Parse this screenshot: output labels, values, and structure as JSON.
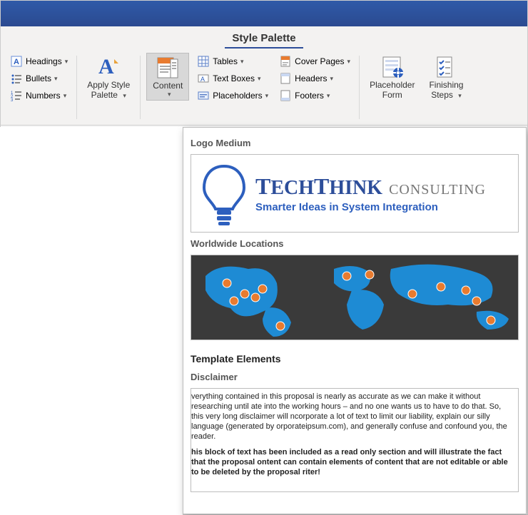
{
  "tab": {
    "label": "Style Palette"
  },
  "ribbon": {
    "styles": {
      "headings": "Headings",
      "bullets": "Bullets",
      "numbers": "Numbers"
    },
    "apply": {
      "label_l1": "Apply Style",
      "label_l2": "Palette"
    },
    "content": {
      "label": "Content"
    },
    "insert_col1": {
      "tables": "Tables",
      "textboxes": "Text Boxes",
      "placeholders": "Placeholders"
    },
    "insert_col2": {
      "cover": "Cover Pages",
      "headers": "Headers",
      "footers": "Footers"
    },
    "form": {
      "label_l1": "Placeholder",
      "label_l2": "Form"
    },
    "finish": {
      "label_l1": "Finishing",
      "label_l2": "Steps"
    }
  },
  "gallery": {
    "logo_head": "Logo Medium",
    "logo_brand_main": "TechThink",
    "logo_brand_sub": "CONSULTING",
    "logo_tag": "Smarter Ideas in System Integration",
    "map_head": "Worldwide Locations",
    "elem_head": "Template Elements",
    "disc_head": "Disclaimer",
    "disc_p1": "verything contained in this proposal is nearly as accurate as we can make it without researching until ate into the working hours – and no one wants us to have to do that. So, this very long disclaimer will ncorporate a lot of text to limit our liability, explain our silly language (generated by orporateipsum.com), and generally confuse and confound you, the reader.",
    "disc_p2": "his block of text has been included as a read only section and will illustrate the fact that the proposal ontent can contain elements of content that are not editable or able to be deleted by the proposal riter!"
  }
}
